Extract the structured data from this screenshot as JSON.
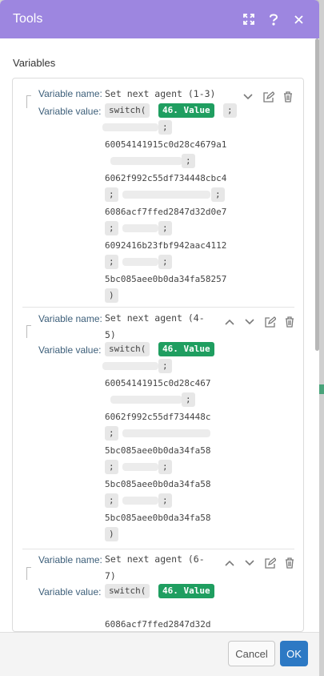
{
  "dialog": {
    "title": "Tools"
  },
  "section": {
    "label": "Variables"
  },
  "labels": {
    "name": "Variable name:",
    "value": "Variable value:"
  },
  "items": [
    {
      "name_line1": "Set next agent (1-3)",
      "name_line2": "",
      "switch_fn": "switch(",
      "value_token": "46. Value",
      "ids": [
        "60054141915c0d28c4679a1",
        "6062f992c55df734448cbc4",
        "6086acf7ffed2847d32d0e7",
        "6092416b23fbf942aac4112",
        "5bc085aee0b0da34fa58257"
      ],
      "sep": ";",
      "close": ")"
    },
    {
      "name_line1": "Set next agent (4-",
      "name_line2": "5)",
      "switch_fn": "switch(",
      "value_token": "46. Value",
      "ids": [
        "60054141915c0d28c467",
        "6062f992c55df734448c",
        "5bc085aee0b0da34fa58",
        "5bc085aee0b0da34fa58",
        "5bc085aee0b0da34fa58"
      ],
      "sep": ";",
      "close": ")"
    },
    {
      "name_line1": "Set next agent (6-",
      "name_line2": "7)",
      "switch_fn": "switch(",
      "value_token": "46. Value",
      "ids": [
        "6086acf7ffed2847d32d"
      ]
    }
  ],
  "buttons": {
    "cancel": "Cancel",
    "ok": "OK"
  },
  "colors": {
    "header": "#9d86e0",
    "value_token": "#1f9e60",
    "ok_button": "#2d79c4"
  }
}
